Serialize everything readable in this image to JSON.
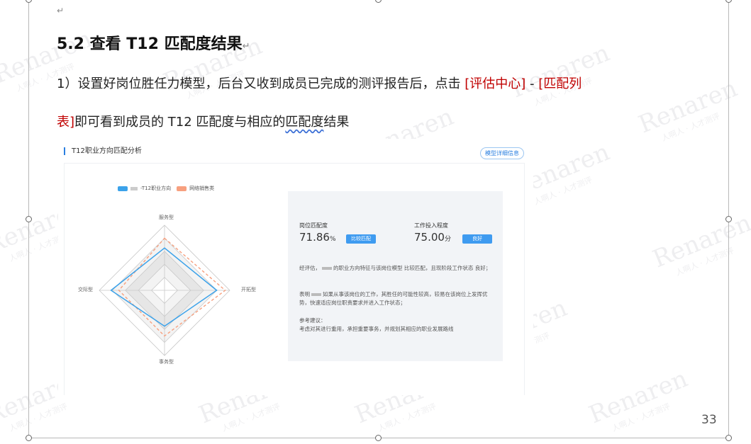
{
  "document": {
    "para_mark": "↵",
    "heading": "5.2 查看 T12 匹配度结果",
    "heading_mark": "↵",
    "line1_prefix": "1）设置好岗位胜任力模型，后台又收到成员已完成的测评报告后，点击",
    "line1_link1": "[评估中心]",
    "line1_dash": " - ",
    "line1_link2": "[匹配列",
    "line2_link2_end": "表]",
    "line2_text": "即可看到成员的 T12 匹配度与相应的",
    "line2_squiggle": "匹配度",
    "line2_end": "结果",
    "page_number": "33"
  },
  "screenshot": {
    "title": "T12职业方向匹配分析",
    "detail_button": "模型详细信息",
    "legend": {
      "member_label": "-T12职业方向",
      "member_color": "#3ba2ea",
      "position_label": "网络销售类",
      "position_color": "#f7a07f"
    },
    "axes": {
      "top": "服务型",
      "right": "开拓型",
      "bottom": "事务型",
      "left": "交际型"
    },
    "radar_values": {
      "member": {
        "服务型": 0.65,
        "开拓型": 0.8,
        "事务型": 0.55,
        "交际型": 0.82
      },
      "position": {
        "服务型": 0.8,
        "开拓型": 0.93,
        "事务型": 0.7,
        "交际型": 0.7
      }
    },
    "result": {
      "fit_label": "岗位匹配度",
      "fit_value": "71.86",
      "fit_unit": "%",
      "fit_tag": "比较匹配",
      "engage_label": "工作投入程度",
      "engage_value": "75.00",
      "engage_unit": "分",
      "engage_tag": "良好",
      "para1_a": "经评估，",
      "para1_b": "的职业方向特征与该岗位模型 比较匹配，且现阶段工作状态 良好；",
      "para2_a": "表明",
      "para2_b": "如果从事该岗位的工作，其胜任的可能性较高，较易在该岗位上发挥优势，快速适应岗位职责要求并进入工作状态；",
      "advice_title": "参考建议：",
      "advice_text": "考虑对其进行重用，承担重要事务，并规划其相应的职业发展路线"
    }
  },
  "watermark": {
    "brand": "Renaren",
    "sub": "人啊人 · 人才测评"
  }
}
